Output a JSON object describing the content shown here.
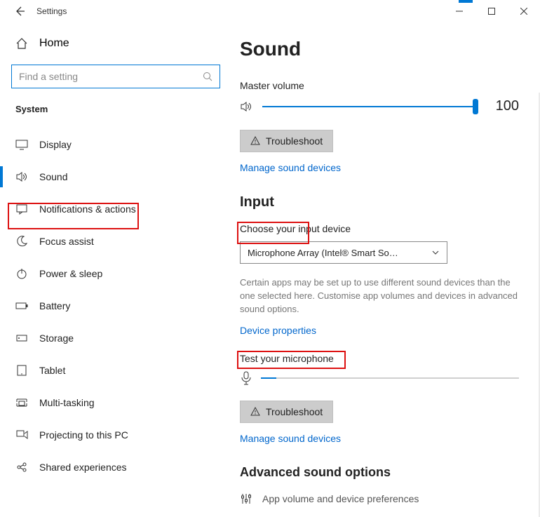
{
  "window": {
    "title": "Settings"
  },
  "sidebar": {
    "home": "Home",
    "search_placeholder": "Find a setting",
    "section": "System",
    "items": [
      {
        "label": "Display"
      },
      {
        "label": "Sound"
      },
      {
        "label": "Notifications & actions"
      },
      {
        "label": "Focus assist"
      },
      {
        "label": "Power & sleep"
      },
      {
        "label": "Battery"
      },
      {
        "label": "Storage"
      },
      {
        "label": "Tablet"
      },
      {
        "label": "Multi-tasking"
      },
      {
        "label": "Projecting to this PC"
      },
      {
        "label": "Shared experiences"
      }
    ]
  },
  "main": {
    "heading": "Sound",
    "master_volume_label": "Master volume",
    "volume_value": "100",
    "troubleshoot": "Troubleshoot",
    "manage_devices": "Manage sound devices",
    "input_heading": "Input",
    "choose_input_label": "Choose your input device",
    "input_device": "Microphone Array (Intel® Smart So…",
    "input_note": "Certain apps may be set up to use different sound devices than the one selected here. Customise app volumes and devices in advanced sound options.",
    "device_properties": "Device properties",
    "test_mic_label": "Test your microphone",
    "troubleshoot2": "Troubleshoot",
    "manage_devices2": "Manage sound devices",
    "advanced_heading": "Advanced sound options",
    "app_prefs": "App volume and device preferences"
  }
}
